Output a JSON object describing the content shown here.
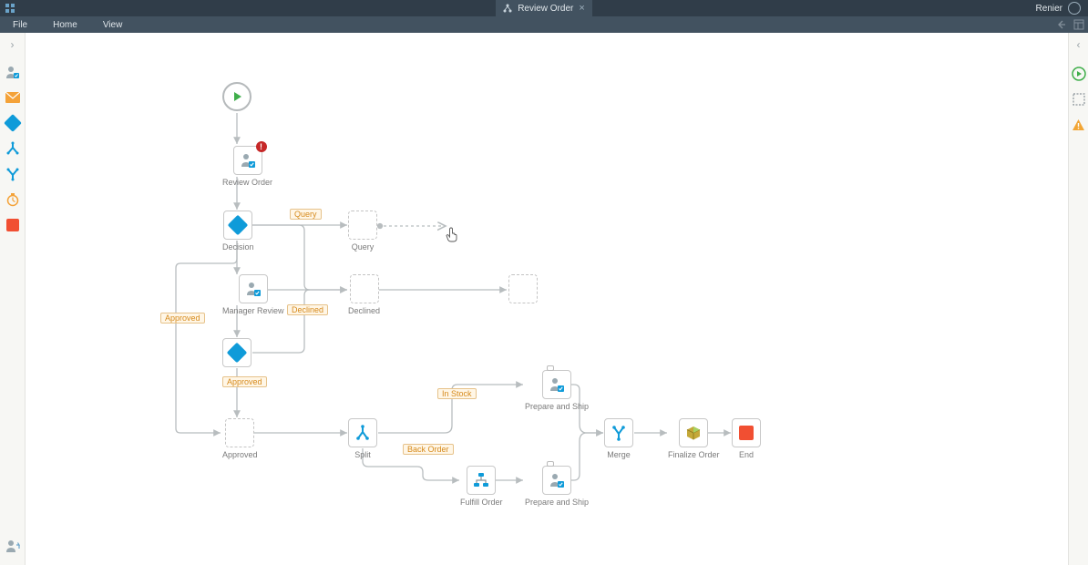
{
  "titlebar": {
    "tab_label": "Review Order",
    "user_name": "Renier"
  },
  "menubar": {
    "file": "File",
    "home": "Home",
    "view": "View"
  },
  "palette": {
    "user_task": "user-task",
    "message": "message",
    "decision": "decision",
    "split": "split",
    "merge": "merge",
    "timer": "timer",
    "end": "end",
    "return": "return"
  },
  "right_panel": {
    "run": "run",
    "select": "select",
    "warnings": "warnings"
  },
  "nodes": {
    "start": {
      "label": ""
    },
    "review_order": {
      "label": "Review Order"
    },
    "decision": {
      "label": "Decision"
    },
    "query": {
      "label": "Query"
    },
    "manager_review": {
      "label": "Manager Review"
    },
    "declined": {
      "label": "Declined"
    },
    "decision2": {
      "label": ""
    },
    "approved": {
      "label": "Approved"
    },
    "split": {
      "label": "Split"
    },
    "prepare_ship_1": {
      "label": "Prepare and Ship"
    },
    "fulfill_order": {
      "label": "Fulfill Order"
    },
    "prepare_ship_2": {
      "label": "Prepare and Ship"
    },
    "merge": {
      "label": "Merge"
    },
    "finalize_order": {
      "label": "Finalize Order"
    },
    "end": {
      "label": "End"
    },
    "declined_end": {
      "label": ""
    }
  },
  "edges": {
    "query": "Query",
    "approved_1": "Approved",
    "declined": "Declined",
    "approved_2": "Approved",
    "in_stock": "In Stock",
    "back_order": "Back Order"
  },
  "colors": {
    "titlebar_bg": "#303d49",
    "menubar_bg": "#425260",
    "accent_blue": "#0f9bd9",
    "accent_green": "#3fae4a",
    "accent_red": "#f14f32",
    "accent_amber": "#d68a1c",
    "edge_stroke": "#b8bdbf"
  }
}
